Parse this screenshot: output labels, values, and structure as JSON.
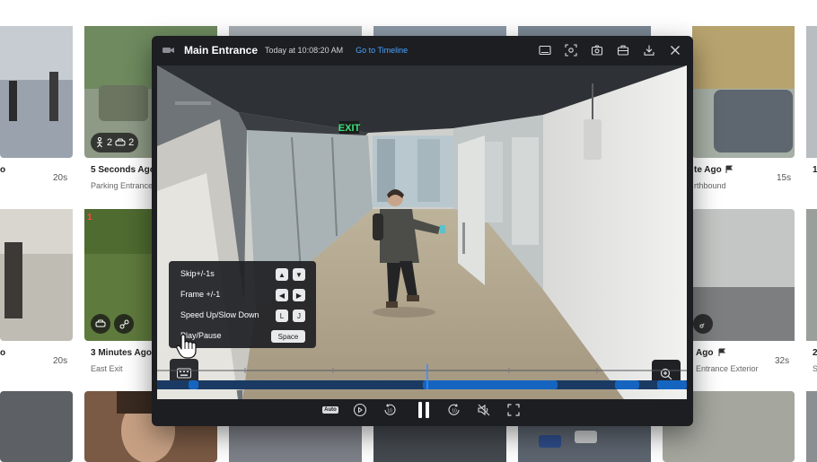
{
  "gallery": {
    "cards": [
      {
        "title": "o",
        "subtitle": "",
        "duration": "20s"
      },
      {
        "title": "5 Seconds Ago",
        "subtitle": "Parking Entrance",
        "duration": ""
      },
      {
        "title": "te Ago",
        "subtitle": "rthbound",
        "duration": "15s"
      },
      {
        "title": "o",
        "subtitle": "",
        "duration": "20s"
      },
      {
        "title": "3 Minutes Ago",
        "subtitle": "East Exit",
        "duration": ""
      },
      {
        "title": "Ago",
        "subtitle": "Entrance Exterior",
        "duration": "32s"
      },
      {
        "title": "1",
        "subtitle": "",
        "duration": ""
      },
      {
        "title": "2",
        "subtitle": "S",
        "duration": ""
      }
    ],
    "badges": {
      "people_count": "2",
      "vehicle_count": "2",
      "corner_number": "1"
    }
  },
  "player": {
    "camera_name": "Main Entrance",
    "timestamp": "Today at 10:08:20 AM",
    "timeline_link": "Go to Timeline",
    "exit_sign": "EXIT",
    "header_icons": [
      "theater-mode-icon",
      "ai-scan-icon",
      "snapshot-icon",
      "share-icon",
      "download-icon",
      "close-icon"
    ],
    "shortcuts": [
      {
        "label": "Skip+/-1s",
        "keys": [
          "▲",
          "▼"
        ]
      },
      {
        "label": "Frame +/-1",
        "keys": [
          "◀",
          "▶"
        ]
      },
      {
        "label": "Speed Up/Slow Down",
        "keys": [
          "L",
          "J"
        ]
      },
      {
        "label": "Play/Pause",
        "keys": [
          "Space"
        ]
      }
    ],
    "controls": {
      "speed_label": "Auto"
    },
    "colors": {
      "accent": "#1565c0",
      "playhead": "#3d8bff",
      "link": "#4aa3ff"
    },
    "timeline": {
      "playhead_fraction": 0.51
    }
  }
}
